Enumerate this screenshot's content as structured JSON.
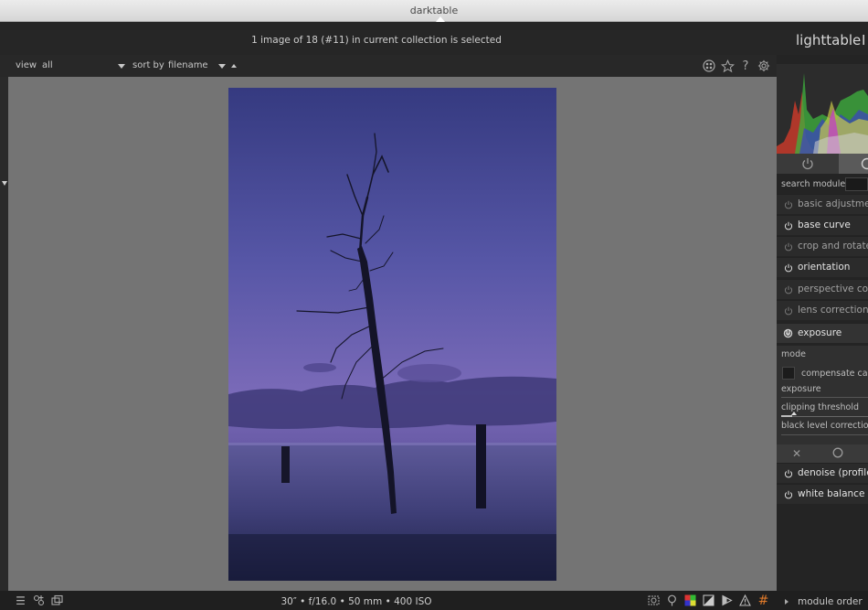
{
  "window": {
    "title": "darktable"
  },
  "header": {
    "selection_status": "1 image of 18 (#11) in current collection is selected",
    "view_name": "lighttable",
    "view_separator": "I"
  },
  "toolbar": {
    "view_label": "view",
    "view_value": "all",
    "sort_label": "sort by",
    "sort_value": "filename",
    "icons": [
      "color-picker-icon",
      "star-icon",
      "help-icon",
      "gear-icon"
    ]
  },
  "right_panel": {
    "search_label": "search module",
    "modules": [
      {
        "name": "basic adjustments",
        "label": "basic adjustmer",
        "enabled": false
      },
      {
        "name": "base curve",
        "label": "base curve",
        "enabled": true
      },
      {
        "name": "crop and rotate",
        "label": "crop and rotate",
        "enabled": false
      },
      {
        "name": "orientation",
        "label": "orientation",
        "enabled": true
      },
      {
        "name": "perspective correction",
        "label": "perspective cor",
        "enabled": false
      },
      {
        "name": "lens correction",
        "label": "lens correction",
        "enabled": false
      },
      {
        "name": "exposure",
        "label": "exposure",
        "enabled": true,
        "expanded": true
      }
    ],
    "exposure_params": {
      "mode_label": "mode",
      "compensate_label": "compensate cam",
      "exposure_label": "exposure",
      "clipping_label": "clipping threshold",
      "black_level_label": "black level correction"
    },
    "modules_after": [
      {
        "name": "denoise (profiled)",
        "label": "denoise (profile",
        "enabled": true
      },
      {
        "name": "white balance",
        "label": "white balance",
        "enabled": true
      }
    ]
  },
  "bottom": {
    "exif": "30″ • f/16.0 • 50 mm • 400 ISO",
    "module_order": "module order"
  },
  "colors": {
    "panel_bg": "#242424",
    "center_bg": "#747474",
    "sky_top": "#3b3f86",
    "sky_mid": "#6f63b0"
  }
}
